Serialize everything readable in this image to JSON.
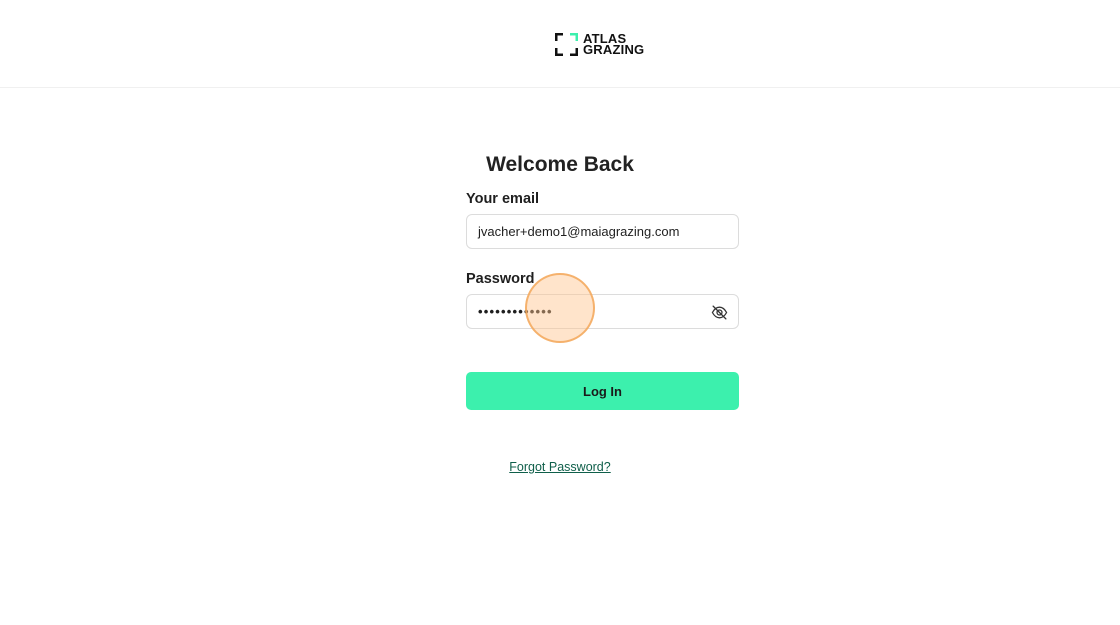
{
  "brand": {
    "line1": "ATLAS",
    "line2": "GRAZING",
    "accent_color": "#3cf0ad",
    "logo_icon": "corner-brackets-icon"
  },
  "login": {
    "title": "Welcome Back",
    "email_label": "Your email",
    "email_value": "jvacher+demo1@maiagrazing.com",
    "password_label": "Password",
    "password_masked": "•••••••••••••",
    "password_toggle_icon": "eye-off-icon",
    "submit_label": "Log In",
    "forgot_label": "Forgot Password?"
  },
  "colors": {
    "button_bg": "#3cf0ad",
    "link": "#0f5f4a"
  }
}
